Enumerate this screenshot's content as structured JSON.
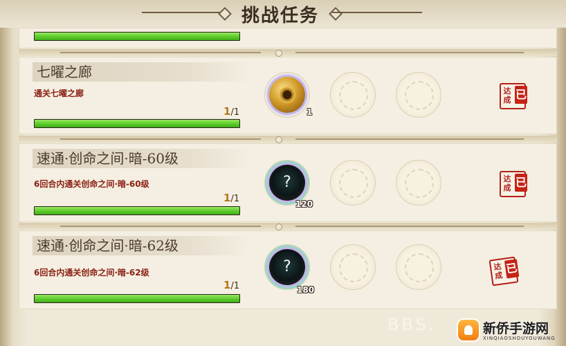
{
  "header": {
    "title": "挑战任务"
  },
  "top_partial_row": {
    "progress_fraction": 1.0
  },
  "tasks": [
    {
      "name": "七曜之廊",
      "description": "通关七曜之廊",
      "progress_current": "1",
      "progress_total": "/1",
      "progress_fraction": 1.0,
      "reward": {
        "icon": "gold-coin-icon",
        "count": "1"
      },
      "stamp": {
        "small": "达成",
        "big": "已"
      }
    },
    {
      "name": "速通·创命之间·暗-60级",
      "description": "6回合内通关创命之间·暗-60级",
      "progress_current": "1",
      "progress_total": "/1",
      "progress_fraction": 1.0,
      "reward": {
        "icon": "mystery-orb-icon",
        "symbol": "?",
        "count": "120"
      },
      "stamp": {
        "small": "达成",
        "big": "已"
      }
    },
    {
      "name": "速通·创命之间·暗-62级",
      "description": "6回合内通关创命之间·暗-62级",
      "progress_current": "1",
      "progress_total": "/1",
      "progress_fraction": 1.0,
      "reward": {
        "icon": "mystery-orb-icon",
        "symbol": "?",
        "count": "180"
      },
      "stamp": {
        "small": "达成",
        "big": "已"
      }
    }
  ],
  "watermark": "BBS.",
  "branding": {
    "name": "新侨手游网",
    "sub": "XINQIAOSHOUYOUWANG"
  },
  "colors": {
    "progress_green": "#5fcf2c",
    "stamp_red": "#c52316",
    "desc_red": "#8a1f12"
  }
}
